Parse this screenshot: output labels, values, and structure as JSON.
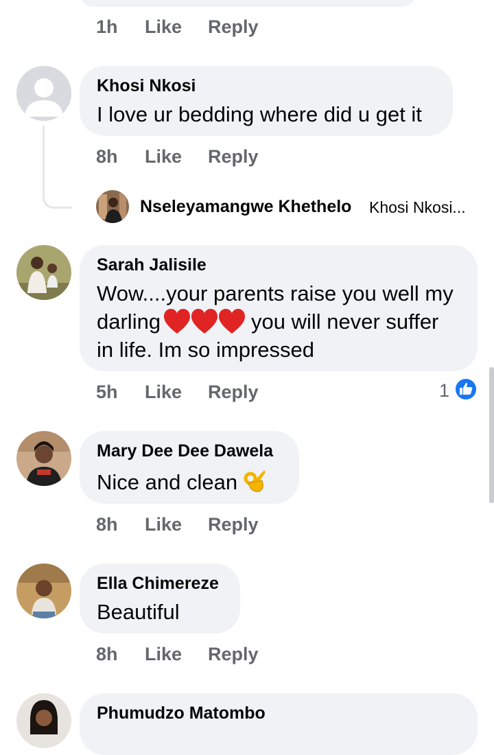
{
  "actions": {
    "like": "Like",
    "reply": "Reply"
  },
  "top_comment": {
    "time": "1h"
  },
  "comments": [
    {
      "author": "Khosi Nkosi",
      "lines": [
        "I love ur bedding where did u get it"
      ],
      "time": "8h"
    },
    {
      "author": "Sarah Jalisile",
      "lines": [
        "Wow....your parents raise you well my",
        "darling",
        "you will never suffer",
        "in life. Im so impressed"
      ],
      "time": "5h",
      "reactions": "1"
    },
    {
      "author": "Mary Dee Dee Dawela",
      "lines": [
        "Nice and clean"
      ],
      "time": "8h"
    },
    {
      "author": "Ella Chimereze",
      "lines": [
        "Beautiful"
      ],
      "time": "8h"
    },
    {
      "author": "Phumudzo Matombo"
    }
  ],
  "reply_preview": {
    "author": "Nseleyamangwe Khethelo",
    "snippet": "Khosi Nkosi..."
  },
  "colors": {
    "bubble": "#f0f2f5",
    "meta": "#65676b",
    "like_blue": "#1877f2",
    "heart": "#e02424"
  },
  "icons": {
    "default_avatar": "person-silhouette-icon",
    "reaction": "like-thumb-icon",
    "hearts": "red-heart-emoji",
    "ok_hand": "ok-hand-emoji"
  }
}
